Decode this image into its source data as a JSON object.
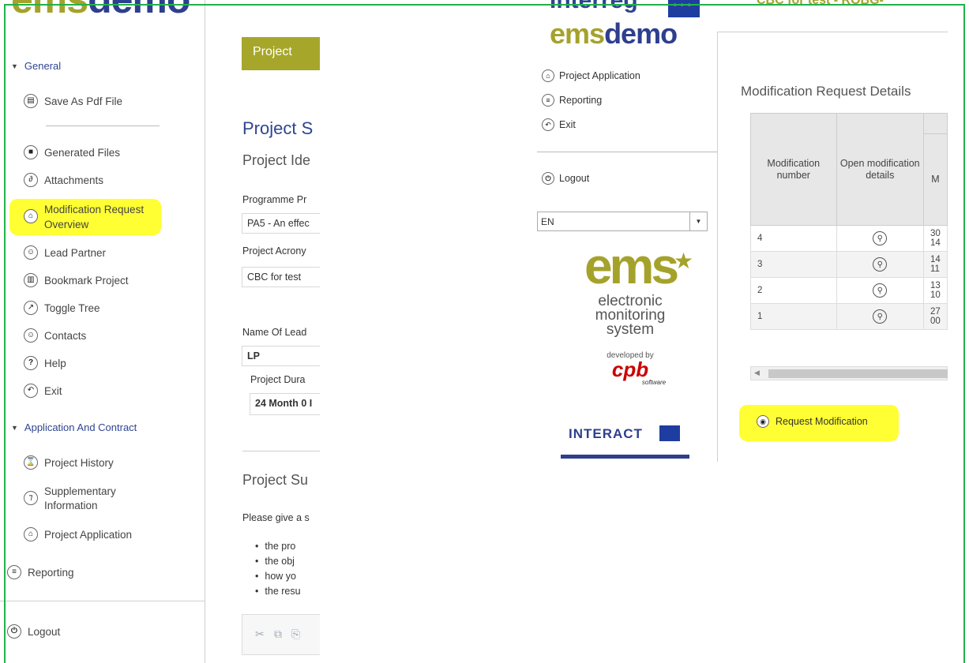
{
  "sidebar": {
    "brand": {
      "part1": "ems",
      "part2": "demo"
    },
    "general_label": "General",
    "general_items": [
      {
        "label": "Save As Pdf File",
        "icon": "printer-icon"
      },
      {
        "label": "Generated Files",
        "icon": "save-icon"
      },
      {
        "label": "Attachments",
        "icon": "paperclip-icon"
      },
      {
        "label": "Modification Request Overview",
        "icon": "bank-icon",
        "highlighted": true
      },
      {
        "label": "Lead Partner",
        "icon": "user-icon"
      },
      {
        "label": "Bookmark Project",
        "icon": "bookmark-icon"
      },
      {
        "label": "Toggle Tree",
        "icon": "expand-icon"
      },
      {
        "label": "Contacts",
        "icon": "user-icon"
      },
      {
        "label": "Help",
        "icon": "question-icon"
      },
      {
        "label": "Exit",
        "icon": "undo-icon"
      }
    ],
    "app_label": "Application And Contract",
    "app_items": [
      {
        "label": "Project History",
        "icon": "history-icon"
      },
      {
        "label": "Supplementary Information",
        "icon": "info-icon"
      },
      {
        "label": "Project Application",
        "icon": "bank-icon"
      }
    ],
    "reporting": "Reporting",
    "logout": "Logout"
  },
  "form": {
    "tab": "Project",
    "title": "Project S",
    "identification": "Project Ide",
    "programme_priority_label": "Programme Pr",
    "programme_priority_value": "PA5 - An effec",
    "acronym_label": "Project Acrony",
    "acronym_value": "CBC for test",
    "lead_partner_label": "Name Of Lead",
    "lead_partner_value": "LP",
    "duration_label": "Project Dura",
    "duration_value": "24 Month 0 I",
    "summary_heading": "Project Su",
    "summary_prompt": "Please give a s",
    "summary_bullets": [
      "the pro",
      "the obj",
      "how yo",
      "the resu"
    ]
  },
  "overlay": {
    "brand_top": "Interreg",
    "brand": {
      "part1": "ems",
      "part2": "demo"
    },
    "header_crop": "CBC for test - ROBG-",
    "nav": [
      {
        "label": "Project Application",
        "icon": "bank-icon"
      },
      {
        "label": "Reporting",
        "icon": "report-icon"
      },
      {
        "label": "Exit",
        "icon": "undo-icon"
      }
    ],
    "logout": "Logout",
    "language": "EN",
    "logo": {
      "main": "ems",
      "line1": "electronic",
      "line2": "monitoring",
      "line3": "system",
      "developed_by": "developed by",
      "cpb": "cpb",
      "cpb_sub": "software",
      "interact": "INTERACT"
    },
    "details_title": "Modification Request Details",
    "table": {
      "headers": [
        "Modification number",
        "Open modification details",
        "M"
      ],
      "rows": [
        {
          "num": "4",
          "date1": "30",
          "date2": "14"
        },
        {
          "num": "3",
          "date1": "14",
          "date2": "11"
        },
        {
          "num": "2",
          "date1": "13",
          "date2": "10"
        },
        {
          "num": "1",
          "date1": "27",
          "date2": "00"
        }
      ]
    },
    "request_button": "Request Modification"
  },
  "colors": {
    "highlight": "#ffff33",
    "brand_olive": "#a5a22c",
    "brand_blue": "#2e4591",
    "frame_green": "#22b14c"
  }
}
